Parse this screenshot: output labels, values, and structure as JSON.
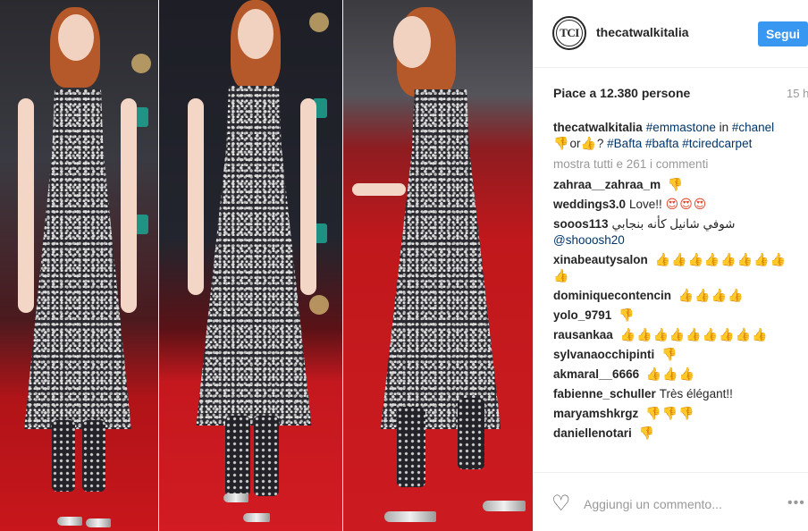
{
  "header": {
    "avatar_text": "TCI",
    "username": "thecatwalkitalia",
    "follow_label": "Segui"
  },
  "post": {
    "likes_text": "Piace a 12.380 persone",
    "time_text": "15 h"
  },
  "caption": {
    "username": "thecatwalkitalia",
    "tag_emmastone": "#emmastone",
    "word_in": "in",
    "tag_chanel": "#chanel",
    "word_or": "or",
    "question": "?",
    "tag_bafta1": "#Bafta",
    "tag_bafta2": "#bafta",
    "tag_tciredcarpet": "#tciredcarpet"
  },
  "view_all_label": "mostra tutti e 261 i commenti",
  "comments": [
    {
      "username": "zahraa__zahraa_m",
      "text": ""
    },
    {
      "username": "weddings3.0",
      "text": "Love!!"
    },
    {
      "username": "sooos113",
      "text": "شوفي شانيل كأنه بنجابي",
      "mention": "@shooosh20"
    },
    {
      "username": "xinabeautysalon",
      "text": ""
    },
    {
      "username": "dominiquecontencin",
      "text": ""
    },
    {
      "username": "yolo_9791",
      "text": ""
    },
    {
      "username": "rausankaa",
      "text": ""
    },
    {
      "username": "sylvanaocchipinti",
      "text": ""
    },
    {
      "username": "akmaral__6666",
      "text": ""
    },
    {
      "username": "fabienne_schuller",
      "text": "Très élégant!!"
    },
    {
      "username": "maryamshkrgz",
      "text": ""
    },
    {
      "username": "daniellenotari",
      "text": ""
    }
  ],
  "emoji": {
    "thumbs_up": "👍",
    "thumbs_down": "👎",
    "heart_eyes": "😍"
  },
  "footer": {
    "comment_placeholder": "Aggiungi un commento...",
    "like_icon": "heart-outline-icon",
    "more_icon": "more-options-icon"
  },
  "colors": {
    "follow_button": "#3897f0",
    "hashtag": "#003569",
    "secondary_text": "#999999",
    "red_carpet": "#c8161c"
  }
}
